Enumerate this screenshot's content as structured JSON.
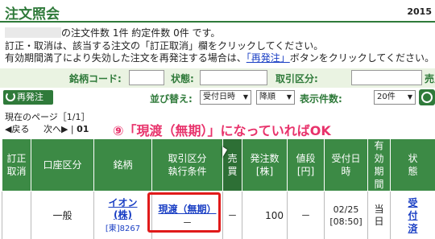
{
  "header": {
    "title": "注文照会",
    "year": "2015"
  },
  "summary": {
    "text": "の注文件数 1件 約定件数 0件 です。"
  },
  "notice1": {
    "text": "訂正・取消は、該当する注文の「訂正取消」欄をクリックしてください。"
  },
  "notice2": {
    "before": "有効期間満了により失効した注文を再発注する場合は、",
    "link": "「再発注」",
    "after": "ボタンをクリックしてください。"
  },
  "filters": {
    "stock_code": "銘柄コード:",
    "status": "状態:",
    "trade_type": "取引区分:",
    "buy_sell": "売買"
  },
  "repost_button": "再発注",
  "sort": {
    "label": "並び替え:",
    "field": "受付日時",
    "order": "降順",
    "count_label": "表示件数:",
    "count": "20件"
  },
  "page_info": "現在のページ［1/1］",
  "pager": {
    "prev": "◀戻る",
    "next": "次へ▶",
    "pages": "01"
  },
  "annotation": "⑨「現渡（無期）」になっていればOK",
  "table": {
    "headers": [
      "訂正\n取消",
      "口座区分",
      "銘柄",
      "取引区分\n執行条件",
      "売\n買",
      "発注数\n[株]",
      "値段\n[円]",
      "受付日\n時",
      "有\n効\n期\n間",
      "状\n態"
    ],
    "row": {
      "cancel": "",
      "account": "一般",
      "stock_name": "イオン\n(株)",
      "stock_code": "[東]8267",
      "trade_type": "現渡（無期）",
      "exec_cond": "－",
      "buy_sell": "－",
      "qty": "100",
      "price": "－",
      "received": "02/25\n[08:50]",
      "validity": "当\n日",
      "status": "受\n付\n済"
    }
  },
  "colors": {
    "brand_green": "#2f7a3a",
    "header_green": "#3c8a45",
    "annotation_pink": "#e8326b",
    "highlight_red": "#e01a1a",
    "link_blue": "#1a3fc4"
  }
}
